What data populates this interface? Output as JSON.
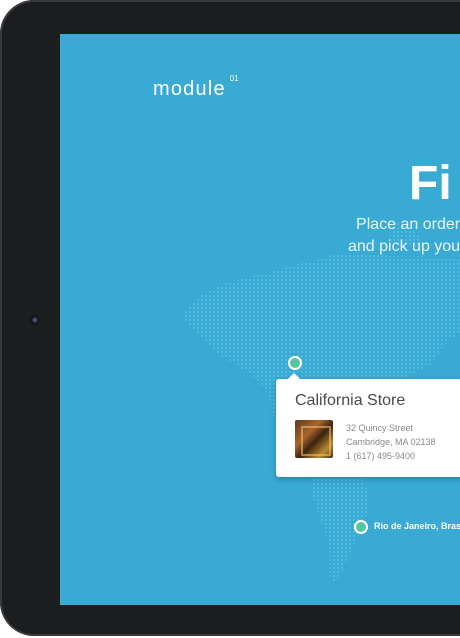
{
  "app": {
    "logo_text": "module",
    "logo_sup": "01"
  },
  "hero": {
    "title": "Fi",
    "tagline_line1": "Place an order",
    "tagline_line2": "and pick up you"
  },
  "store_card": {
    "name": "California Store",
    "address_line1": "32 Quincy Street",
    "address_line2": "Cambridge, MA 02138",
    "phone": "1 (617) 495-9400"
  },
  "pins": {
    "rio_label": "Rio de Janeiro, Brasil"
  },
  "colors": {
    "screen_bg": "#38aad4",
    "pin_green": "#56c6a2",
    "device_bezel": "#1c1d1f"
  }
}
